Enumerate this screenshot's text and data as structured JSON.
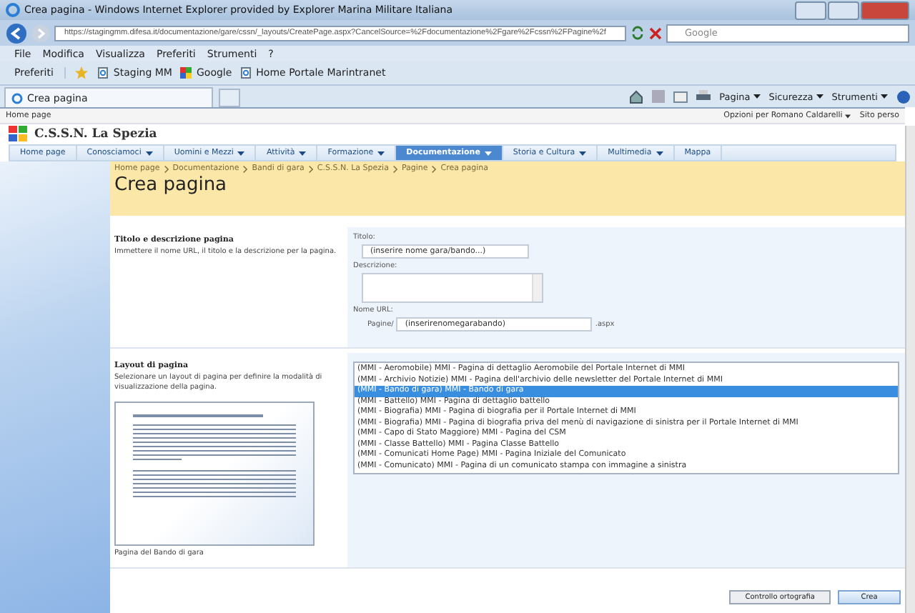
{
  "window": {
    "title": "Crea pagina - Windows Internet Explorer provided by Explorer Marina Militare Italiana"
  },
  "address_bar": {
    "url": "https://stagingmm.difesa.it/documentazione/gare/cssn/_layouts/CreatePage.aspx?CancelSource=%2Fdocumentazione%2Fgare%2Fcssn%2FPagine%2f"
  },
  "search": {
    "placeholder": "Google"
  },
  "menu_bar": [
    "File",
    "Modifica",
    "Visualizza",
    "Preferiti",
    "Strumenti",
    "?"
  ],
  "favorites_bar": {
    "label": "Preferiti",
    "links": [
      {
        "label": "Staging MM",
        "kind": "page"
      },
      {
        "label": "Google",
        "kind": "google"
      },
      {
        "label": "Home Portale Marintranet",
        "kind": "page"
      }
    ]
  },
  "tab": {
    "label": "Crea pagina"
  },
  "command_bar": [
    "Pagina",
    "Sicurezza",
    "Strumenti"
  ],
  "site_header": {
    "top_link": "Home page",
    "user_menu": "Opzioni per Romano Caldarelli",
    "site_link": "Sito perso",
    "site_title": "C.S.S.N. La Spezia"
  },
  "nav_tabs": [
    {
      "label": "Home page",
      "selected": false,
      "has_menu": false
    },
    {
      "label": "Conosciamoci",
      "selected": false,
      "has_menu": true
    },
    {
      "label": "Uomini e Mezzi",
      "selected": false,
      "has_menu": true
    },
    {
      "label": "Attività",
      "selected": false,
      "has_menu": true
    },
    {
      "label": "Formazione",
      "selected": false,
      "has_menu": true
    },
    {
      "label": "Documentazione",
      "selected": true,
      "has_menu": true
    },
    {
      "label": "Storia e Cultura",
      "selected": false,
      "has_menu": true
    },
    {
      "label": "Multimedia",
      "selected": false,
      "has_menu": true
    },
    {
      "label": "Mappa",
      "selected": false,
      "has_menu": false
    }
  ],
  "breadcrumb": [
    "Home page",
    "Documentazione",
    "Bandi di gara",
    "C.S.S.N. La Spezia",
    "Pagine",
    "Crea pagina"
  ],
  "page_title": "Crea pagina",
  "title_section": {
    "heading": "Titolo e descrizione pagina",
    "description": "Immettere il nome URL, il titolo e la descrizione per la pagina.",
    "title_label": "Titolo:",
    "title_value": "(inserire nome gara/bando...)",
    "description_label": "Descrizione:",
    "url_label": "Nome URL:",
    "url_prefix": "Pagine/",
    "url_value": "(inserirenomegarabando)",
    "url_suffix": ".aspx"
  },
  "layout_section": {
    "heading": "Layout di pagina",
    "description": "Selezionare un layout di pagina per definire la modalità di visualizzazione della pagina.",
    "preview_caption": "Pagina del Bando di gara",
    "options": [
      {
        "label": "(MMI - Aeromobile) MMI - Pagina di dettaglio Aeromobile del Portale Internet di MMI",
        "selected": false
      },
      {
        "label": "(MMI - Archivio Notizie) MMI - Pagina dell'archivio delle newsletter del Portale Internet di MMI",
        "selected": false
      },
      {
        "label": "(MMI - Bando di gara) MMI - Bando di gara",
        "selected": true
      },
      {
        "label": "(MMI - Battello) MMI - Pagina di dettaglio battello",
        "selected": false
      },
      {
        "label": "(MMI - Biografia) MMI - Pagina di biografia per il Portale Internet di MMI",
        "selected": false
      },
      {
        "label": "(MMI - Biografia) MMI - Pagina di biografia priva del menù di navigazione di sinistra per il Portale Internet di MMI",
        "selected": false
      },
      {
        "label": "(MMI - Capo di Stato Maggiore) MMI - Pagina del CSM",
        "selected": false
      },
      {
        "label": "(MMI - Classe Battello) MMI - Pagina Classe Battello",
        "selected": false
      },
      {
        "label": "(MMI - Comunicati Home Page) MMI - Pagina Iniziale del Comunicato",
        "selected": false
      },
      {
        "label": "(MMI - Comunicato) MMI - Pagina di un comunicato stampa con immagine a sinistra",
        "selected": false
      }
    ]
  },
  "buttons": [
    {
      "label": "Controllo ortografia",
      "kind": "secondary"
    },
    {
      "label": "Crea",
      "kind": "primary"
    }
  ]
}
